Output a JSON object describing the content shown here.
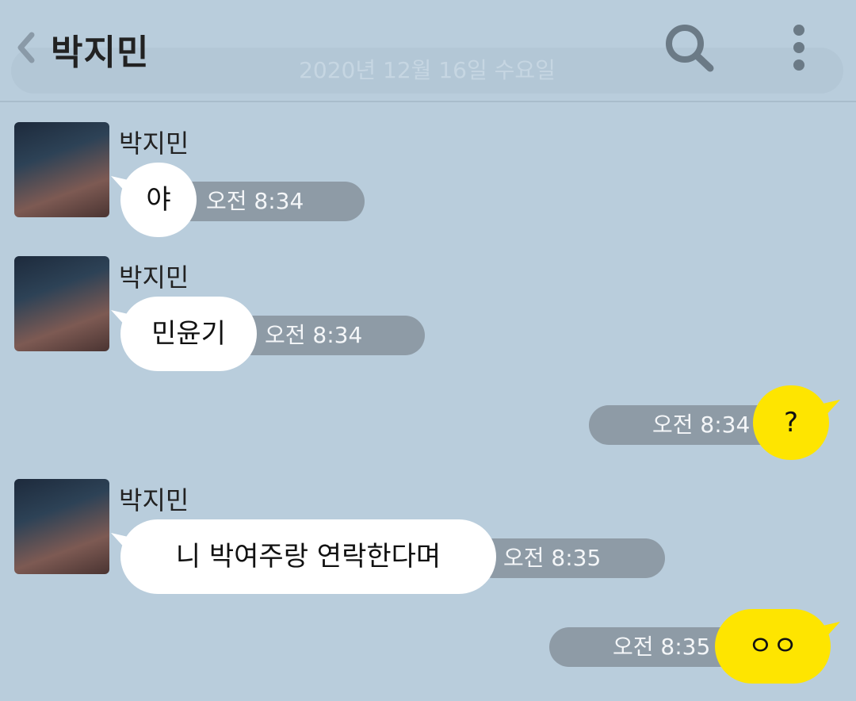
{
  "header": {
    "title": "박지민",
    "date": "2020년 12월 16일 수요일"
  },
  "colors": {
    "background": "#b9cddc",
    "bubble_self": "#fee500",
    "bubble_other": "#ffffff",
    "time_pill": "#8e9ba6"
  },
  "icons": {
    "back": "chevron-left-icon",
    "search": "search-icon",
    "menu": "vertical-dots-icon",
    "avatar": "profile-photo"
  },
  "messages": [
    {
      "sender": "박지민",
      "text": "야",
      "time": "오전 8:34"
    },
    {
      "sender": "박지민",
      "text": "민윤기",
      "time": "오전 8:34"
    },
    {
      "sender": "me",
      "text": "?",
      "time": "오전 8:34"
    },
    {
      "sender": "박지민",
      "text": "니 박여주랑 연락한다며",
      "time": "오전 8:35"
    },
    {
      "sender": "me",
      "text": "ㅇㅇ",
      "time": "오전 8:35"
    }
  ]
}
